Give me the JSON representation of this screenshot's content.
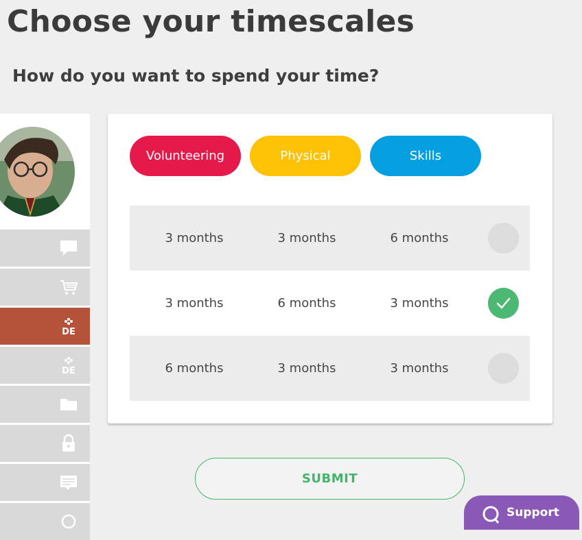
{
  "page": {
    "title": "Choose your timescales",
    "subtitle": "How do you want to spend your time?"
  },
  "sidebar": {
    "avatar_alt": "user-avatar",
    "items": [
      {
        "icon": "chat-icon",
        "active": false
      },
      {
        "icon": "shopping-cart-icon",
        "active": false
      },
      {
        "icon": "dofe-award-icon",
        "active": true
      },
      {
        "icon": "dofe-award-icon",
        "active": false
      },
      {
        "icon": "folder-icon",
        "active": false
      },
      {
        "icon": "lock-icon",
        "active": false
      },
      {
        "icon": "message-board-icon",
        "active": false
      }
    ]
  },
  "sections": {
    "volunteering": "Volunteering",
    "physical": "Physical",
    "skills": "Skills"
  },
  "colors": {
    "volunteering": "#e5194a",
    "physical": "#fec103",
    "skills": "#039fe0",
    "accent_green": "#43b46a",
    "active_sidebar": "#b4533a",
    "support_purple": "#8a59b8"
  },
  "options": [
    {
      "volunteering": "3 months",
      "physical": "3 months",
      "skills": "6 months",
      "selected": false
    },
    {
      "volunteering": "3 months",
      "physical": "6 months",
      "skills": "3 months",
      "selected": true
    },
    {
      "volunteering": "6 months",
      "physical": "3 months",
      "skills": "3 months",
      "selected": false
    }
  ],
  "actions": {
    "submit": "SUBMIT",
    "support": "Support"
  }
}
